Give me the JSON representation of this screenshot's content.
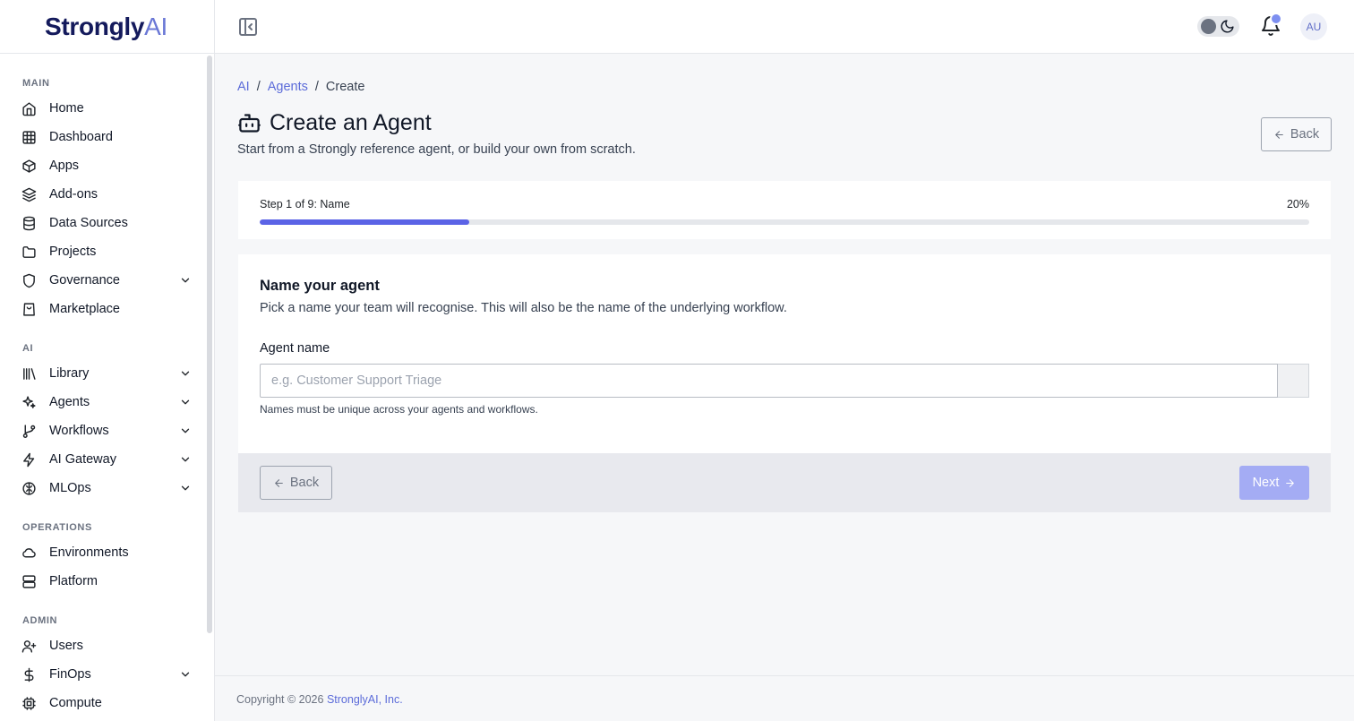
{
  "brand": {
    "name_main": "Strongly",
    "name_accent": "AI"
  },
  "colors": {
    "accent": "#5b63e6",
    "brand_dark": "#141a5c",
    "link": "#5b6bd9",
    "next_disabled": "#a4acf4"
  },
  "sidebar": {
    "sections": {
      "main": "MAIN",
      "ai": "AI",
      "operations": "OPERATIONS",
      "admin": "ADMIN"
    },
    "items": [
      {
        "label": "Home",
        "icon": "home-icon",
        "expandable": false
      },
      {
        "label": "Dashboard",
        "icon": "grid-icon",
        "expandable": false
      },
      {
        "label": "Apps",
        "icon": "box-icon",
        "expandable": false
      },
      {
        "label": "Add-ons",
        "icon": "layers-icon",
        "expandable": false
      },
      {
        "label": "Data Sources",
        "icon": "database-icon",
        "expandable": false
      },
      {
        "label": "Projects",
        "icon": "folder-icon",
        "expandable": false
      },
      {
        "label": "Governance",
        "icon": "shield-icon",
        "expandable": true
      },
      {
        "label": "Marketplace",
        "icon": "shopping-bag-icon",
        "expandable": false
      },
      {
        "label": "Library",
        "icon": "library-icon",
        "expandable": true
      },
      {
        "label": "Agents",
        "icon": "sparkles-icon",
        "expandable": true
      },
      {
        "label": "Workflows",
        "icon": "git-branch-icon",
        "expandable": true
      },
      {
        "label": "AI Gateway",
        "icon": "zap-icon",
        "expandable": true
      },
      {
        "label": "MLOps",
        "icon": "brain-icon",
        "expandable": true
      },
      {
        "label": "Environments",
        "icon": "cloud-icon",
        "expandable": false
      },
      {
        "label": "Platform",
        "icon": "server-icon",
        "expandable": false
      },
      {
        "label": "Users",
        "icon": "user-plus-icon",
        "expandable": false
      },
      {
        "label": "FinOps",
        "icon": "dollar-icon",
        "expandable": true
      },
      {
        "label": "Compute",
        "icon": "cpu-icon",
        "expandable": false
      }
    ]
  },
  "header": {
    "avatar_initials": "AU"
  },
  "breadcrumb": {
    "root": "AI",
    "parent": "Agents",
    "current": "Create",
    "separator": "/"
  },
  "page": {
    "title": "Create an Agent",
    "subtitle": "Start from a Strongly reference agent, or build your own from scratch.",
    "back_label": "Back"
  },
  "progress": {
    "step_label": "Step 1 of 9: Name",
    "percent_label": "20%",
    "percent": 20
  },
  "form": {
    "title": "Name your agent",
    "description": "Pick a name your team will recognise. This will also be the name of the underlying workflow.",
    "field_label": "Agent name",
    "field_value": "",
    "field_placeholder": "e.g. Customer Support Triage",
    "field_help": "Names must be unique across your agents and workflows.",
    "back_label": "Back",
    "next_label": "Next"
  },
  "footer": {
    "copyright_prefix": "Copyright © 2026 ",
    "company": "StronglyAI, Inc."
  }
}
